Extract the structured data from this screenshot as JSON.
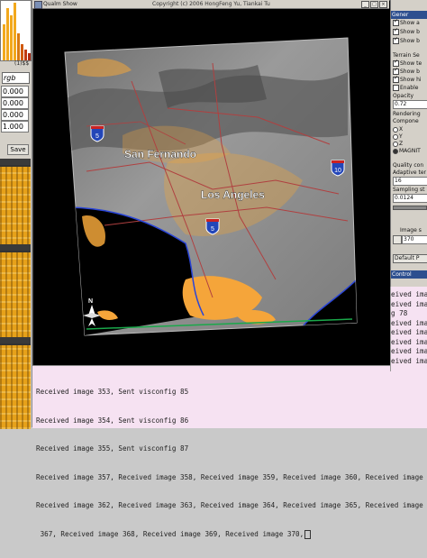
{
  "left_panel": {
    "chart_label": "(1)$$",
    "select_value": "rgb",
    "fields": [
      "0.000",
      "0.000",
      "0.000",
      "1.000"
    ],
    "save_label": "Save"
  },
  "main_window": {
    "title": "Qualm Show",
    "copyright": "Copyright (c) 2006 HongFeng Yu, Tiankai Tu"
  },
  "map": {
    "label_san_fernando": "San Fernando",
    "label_los_angeles": "Los Angeles",
    "compass_label": "N",
    "shields": [
      "5",
      "10",
      "5"
    ]
  },
  "right_panel": {
    "header_top": "Gener",
    "check_items": [
      "Show a",
      "Show b",
      "Show b"
    ],
    "terrain_header": "Terrain Se",
    "terrain_items": [
      "Show te",
      "Show b",
      "Show hi",
      "Enable"
    ],
    "opacity_label": "Opacity",
    "opacity_value": "0.72",
    "rendering_label": "Rendering",
    "component_label": "Compone",
    "component_options": [
      "X",
      "Y",
      "Z",
      "MAGNIT"
    ],
    "quality_label": "Quality con",
    "adaptive_label": "Adaptive ter",
    "adaptive_value": "16",
    "sampling_label": "Sampling st",
    "sampling_value": "0.0124",
    "image_label": "Image s",
    "image_value": "370",
    "default_label": "Default P",
    "control_header": "Control"
  },
  "log": {
    "lines": [
      "Received image 353, Sent visconfig 85",
      "Received image 354, Sent visconfig 86",
      "Received image 355, Sent visconfig 87",
      "Received image 357, Received image 358, Received image 359, Received image 360, Received image",
      "Received image 362, Received image 363, Received image 364, Received image 365, Received image",
      " 367, Received image 368, Received image 369, Received image 370,"
    ],
    "side_lines": [
      "eived image",
      "eived image",
      "g 78",
      "eived image",
      "eived image",
      "eived image",
      "eived image",
      "eived image"
    ]
  },
  "colors": {
    "terrain": "#8a8a8a",
    "ocean": "#000000",
    "wave": "#f2a63a",
    "roads": "#b04040",
    "coast": "#2a45d8",
    "log_bg": "#f6e2f2"
  },
  "icons": [
    "window-icon",
    "compass-arrow-icon",
    "interstate-shield-icon"
  ]
}
